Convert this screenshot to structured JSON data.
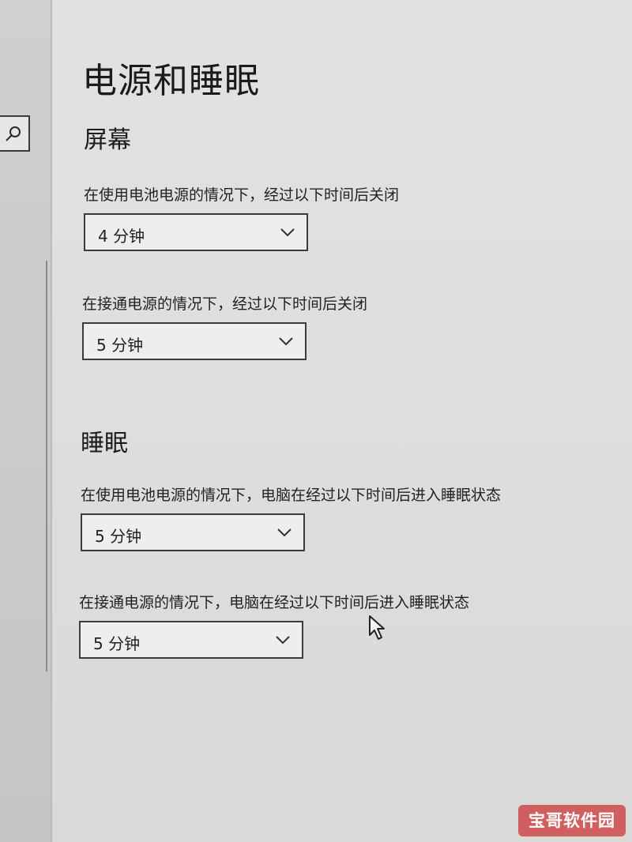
{
  "page": {
    "title": "电源和睡眠"
  },
  "screen": {
    "heading": "屏幕",
    "battery_label": "在使用电池电源的情况下，经过以下时间后关闭",
    "battery_value": "4 分钟",
    "plugged_label": "在接通电源的情况下，经过以下时间后关闭",
    "plugged_value": "5 分钟"
  },
  "sleep": {
    "heading": "睡眠",
    "battery_label": "在使用电池电源的情况下，电脑在经过以下时间后进入睡眠状态",
    "battery_value": "5 分钟",
    "plugged_label": "在接通电源的情况下，电脑在经过以下时间后进入睡眠状态",
    "plugged_value": "5 分钟"
  },
  "icons": {
    "search": "search-icon",
    "dropdown": "chevron-down-icon",
    "pointer": "mouse-pointer-icon"
  },
  "watermark": {
    "text": "宝哥软件园"
  },
  "colors": {
    "background": "#dededd",
    "text": "#1b1b1b",
    "border": "#3b3b3b",
    "watermark": "#cd3c3c"
  }
}
